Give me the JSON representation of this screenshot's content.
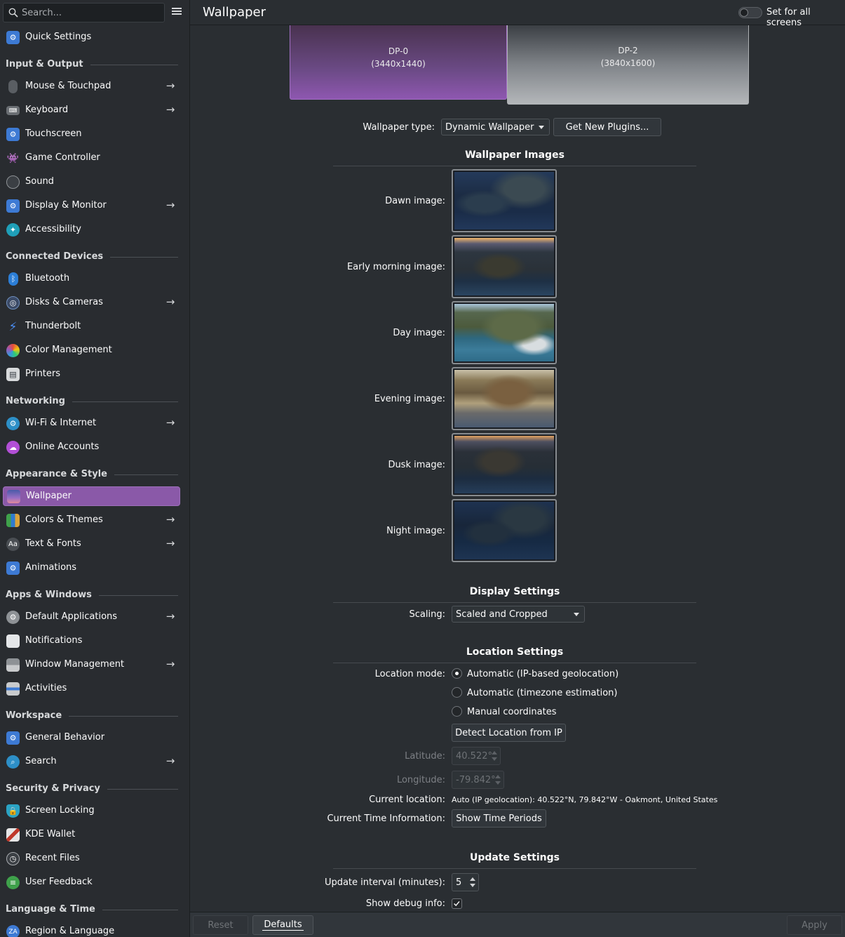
{
  "search": {
    "placeholder": "Search..."
  },
  "sidebar": {
    "groups": {
      "input_output": "Input & Output",
      "connected_devices": "Connected Devices",
      "networking": "Networking",
      "appearance_style": "Appearance & Style",
      "apps_windows": "Apps & Windows",
      "workspace": "Workspace",
      "security_privacy": "Security & Privacy",
      "language_time": "Language & Time"
    },
    "items": {
      "quick_settings": "Quick Settings",
      "mouse_touchpad": "Mouse & Touchpad",
      "keyboard": "Keyboard",
      "touchscreen": "Touchscreen",
      "game_controller": "Game Controller",
      "sound": "Sound",
      "display_monitor": "Display & Monitor",
      "accessibility": "Accessibility",
      "bluetooth": "Bluetooth",
      "disks_cameras": "Disks & Cameras",
      "thunderbolt": "Thunderbolt",
      "color_management": "Color Management",
      "printers": "Printers",
      "wifi_internet": "Wi-Fi & Internet",
      "online_accounts": "Online Accounts",
      "wallpaper": "Wallpaper",
      "colors_themes": "Colors & Themes",
      "text_fonts": "Text & Fonts",
      "animations": "Animations",
      "default_applications": "Default Applications",
      "notifications": "Notifications",
      "window_management": "Window Management",
      "activities": "Activities",
      "general_behavior": "General Behavior",
      "search": "Search",
      "screen_locking": "Screen Locking",
      "kde_wallet": "KDE Wallet",
      "recent_files": "Recent Files",
      "user_feedback": "User Feedback",
      "region_language": "Region & Language"
    },
    "active_item": "Wallpaper"
  },
  "header": {
    "title": "Wallpaper",
    "set_all_screens_label": "Set for all screens",
    "set_all_screens_on": false
  },
  "screens": [
    {
      "name": "DP-0",
      "resolution": "(3440x1440)",
      "selected": true
    },
    {
      "name": "DP-2",
      "resolution": "(3840x1600)",
      "selected": false
    }
  ],
  "wallpaper_type": {
    "label": "Wallpaper type:",
    "value": "Dynamic Wallpaper",
    "plugins_button": "Get New Plugins..."
  },
  "wallpaper_images": {
    "title": "Wallpaper Images",
    "rows": [
      {
        "label": "Dawn image:"
      },
      {
        "label": "Early morning image:"
      },
      {
        "label": "Day image:"
      },
      {
        "label": "Evening image:"
      },
      {
        "label": "Dusk image:"
      },
      {
        "label": "Night image:"
      }
    ]
  },
  "display_settings": {
    "title": "Display Settings",
    "scaling_label": "Scaling:",
    "scaling_value": "Scaled and Cropped"
  },
  "location_settings": {
    "title": "Location Settings",
    "mode_label": "Location mode:",
    "options": [
      "Automatic (IP-based geolocation)",
      "Automatic (timezone estimation)",
      "Manual coordinates"
    ],
    "selected_option": "Automatic (IP-based geolocation)",
    "detect_button": "Detect Location from IP",
    "latitude_label": "Latitude:",
    "latitude_value": "40.522°",
    "longitude_label": "Longitude:",
    "longitude_value": "-79.842°",
    "current_location_label": "Current location:",
    "current_location_value": "Auto (IP geolocation): 40.522°N, 79.842°W - Oakmont, United States",
    "time_info_label": "Current Time Information:",
    "time_periods_button": "Show Time Periods"
  },
  "update_settings": {
    "title": "Update Settings",
    "interval_label": "Update interval (minutes):",
    "interval_value": "5",
    "debug_label": "Show debug info:",
    "debug_checked": true
  },
  "bottom_bar": {
    "reset": "Reset",
    "defaults": "Defaults",
    "apply": "Apply"
  },
  "colors": {
    "accent": "#8a59a8",
    "background": "#2a2e32",
    "sidebar": "#292c30"
  }
}
